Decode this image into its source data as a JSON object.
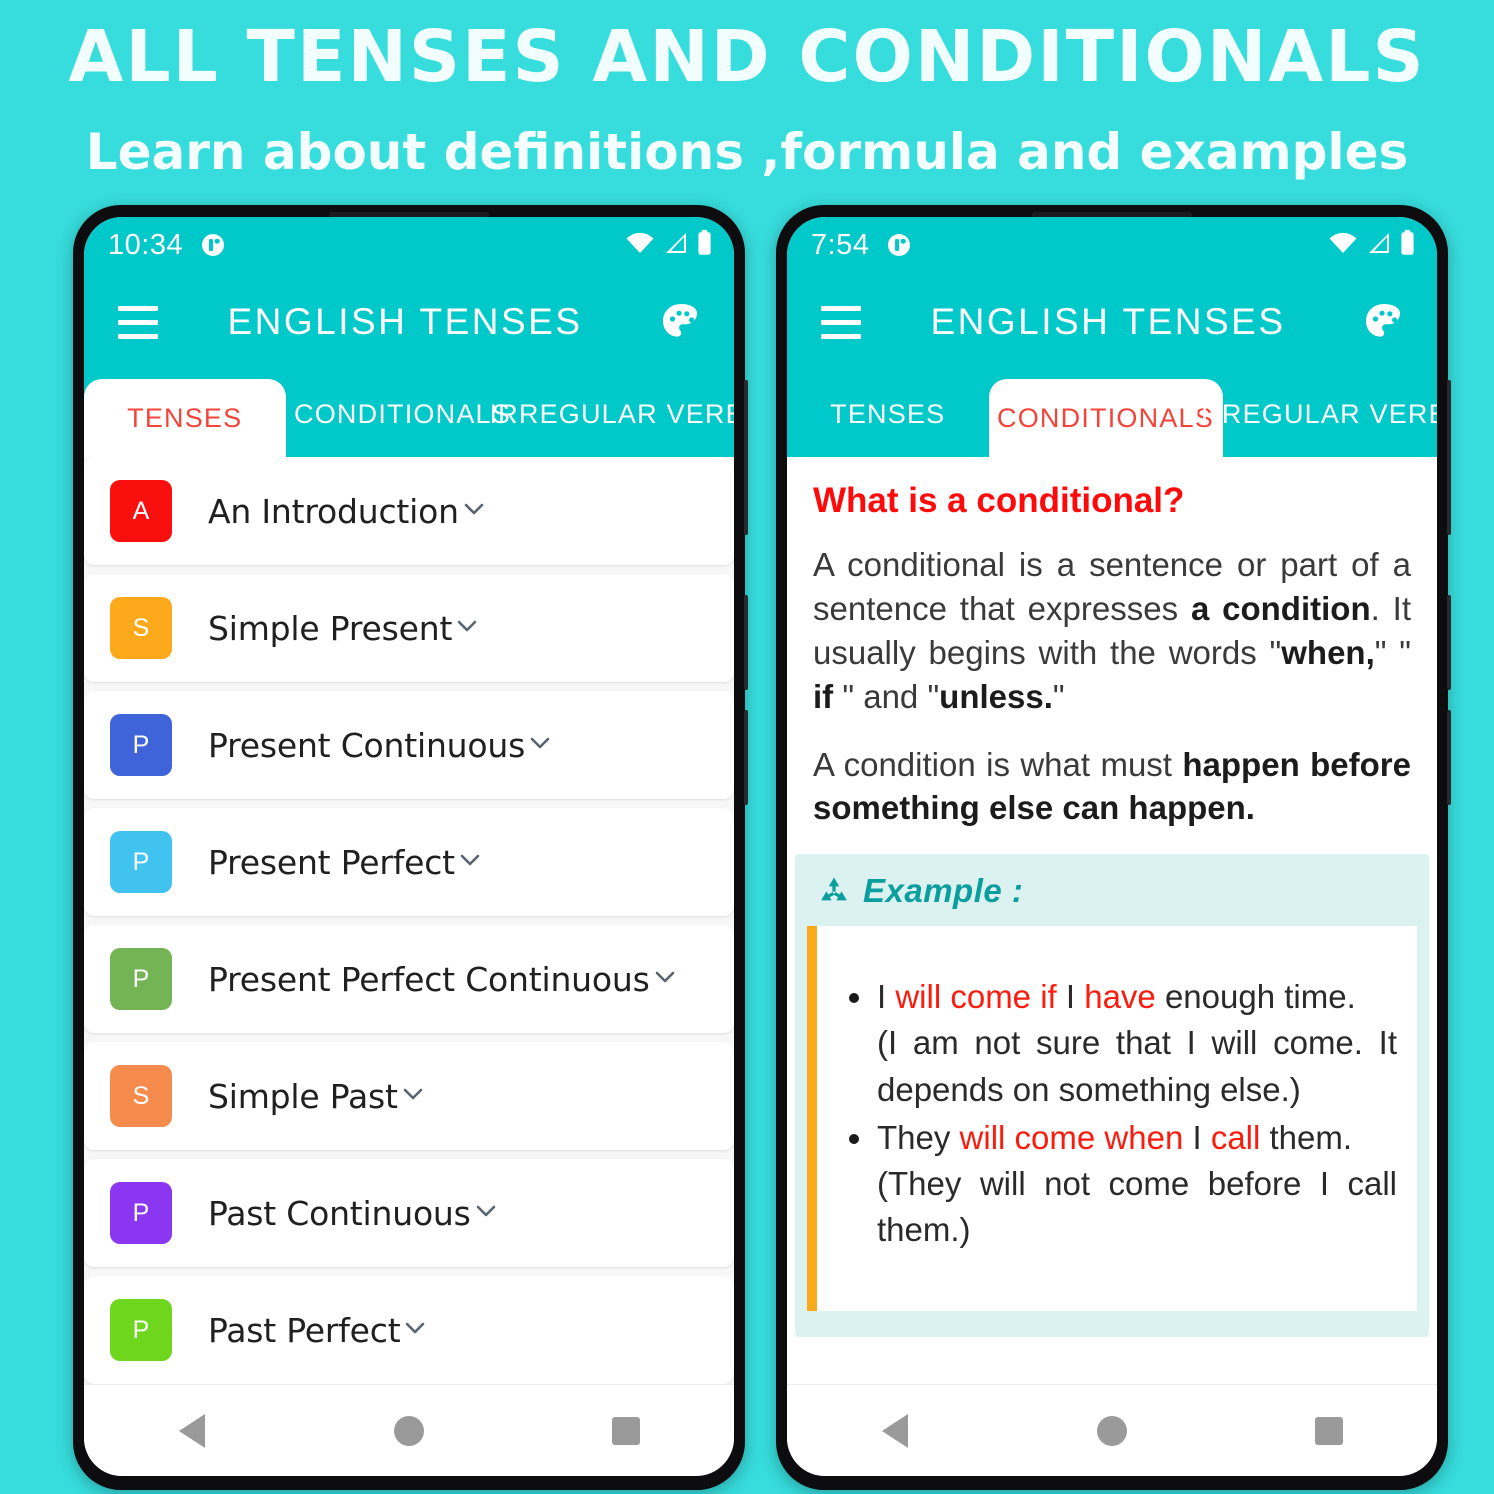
{
  "banner": {
    "title": "ALL TENSES AND CONDITIONALS",
    "subtitle": "Learn about definitions ,formula and examples"
  },
  "colors": {
    "page_background": "#37dcdc",
    "app_bar": "#01c9c9",
    "tab_active_text": "#f4443a",
    "heading_red": "#ff0a0a",
    "example_panel": "#dcf2f1",
    "example_accent": "#f9a91b",
    "example_title": "#0a9e9e",
    "highlight_red": "#fb1c0e"
  },
  "phone_left": {
    "status": {
      "time": "10:34",
      "app_icon": "app-notification-icon",
      "wifi_icon": "wifi-icon",
      "signal_icon": "signal-icon",
      "battery_icon": "battery-icon"
    },
    "appbar": {
      "menu_icon": "hamburger-menu-icon",
      "title": "ENGLISH TENSES",
      "theme_icon": "palette-icon"
    },
    "tabs": [
      {
        "label": "TENSES",
        "active": true
      },
      {
        "label": "CONDITIONALS",
        "active": false
      },
      {
        "label": "IRREGULAR VERBS",
        "active": false
      }
    ],
    "list": [
      {
        "badge": "A",
        "color": "#fa0f0f",
        "label": "An Introduction"
      },
      {
        "badge": "S",
        "color": "#fcaa1b",
        "label": "Simple Present"
      },
      {
        "badge": "P",
        "color": "#3f63d8",
        "label": "Present Continuous"
      },
      {
        "badge": "P",
        "color": "#41c3f0",
        "label": "Present Perfect"
      },
      {
        "badge": "P",
        "color": "#74b455",
        "label": "Present Perfect Continuous"
      },
      {
        "badge": "S",
        "color": "#f68b4e",
        "label": "Simple Past"
      },
      {
        "badge": "P",
        "color": "#8b37f2",
        "label": "Past Continuous"
      },
      {
        "badge": "P",
        "color": "#6ed61c",
        "label": "Past Perfect"
      }
    ],
    "nav": {
      "back": "back-nav-icon",
      "home": "home-nav-icon",
      "recent": "recent-apps-nav-icon"
    }
  },
  "phone_right": {
    "status": {
      "time": "7:54",
      "app_icon": "app-notification-icon",
      "wifi_icon": "wifi-icon",
      "signal_icon": "signal-icon",
      "battery_icon": "battery-icon"
    },
    "appbar": {
      "menu_icon": "hamburger-menu-icon",
      "title": "ENGLISH TENSES",
      "theme_icon": "palette-icon"
    },
    "tabs": [
      {
        "label": "TENSES",
        "active": false
      },
      {
        "label": "CONDITIONALS",
        "active": true
      },
      {
        "label": "IRREGULAR VERBS",
        "active": false
      }
    ],
    "article": {
      "heading": "What is a conditional?",
      "para1_a": "A conditional is a sentence or part of a sentence that expresses ",
      "para1_b": "a condition",
      "para1_c": ". It usually begins with the words \"",
      "para1_d": "when,",
      "para1_e": "\" \" ",
      "para1_f": "if",
      "para1_g": " \" and \"",
      "para1_h": "unless.",
      "para1_i": "\"",
      "para2_a": "A condition is what must ",
      "para2_b": "happen before something else can happen."
    },
    "example": {
      "icon": "recycle-icon",
      "title": "Example :",
      "items": [
        {
          "main_pre": "I ",
          "main_red1": "will come if",
          "main_mid": " I ",
          "main_red2": "have",
          "main_post": " enough time.",
          "paren": "(I am not sure that I will come. It depends on something else.)"
        },
        {
          "main_pre": "They ",
          "main_red1": "will come when",
          "main_mid": " I ",
          "main_red2": "call",
          "main_post": " them.",
          "paren": "(They will not come before I call them.)"
        }
      ]
    },
    "nav": {
      "back": "back-nav-icon",
      "home": "home-nav-icon",
      "recent": "recent-apps-nav-icon"
    }
  }
}
